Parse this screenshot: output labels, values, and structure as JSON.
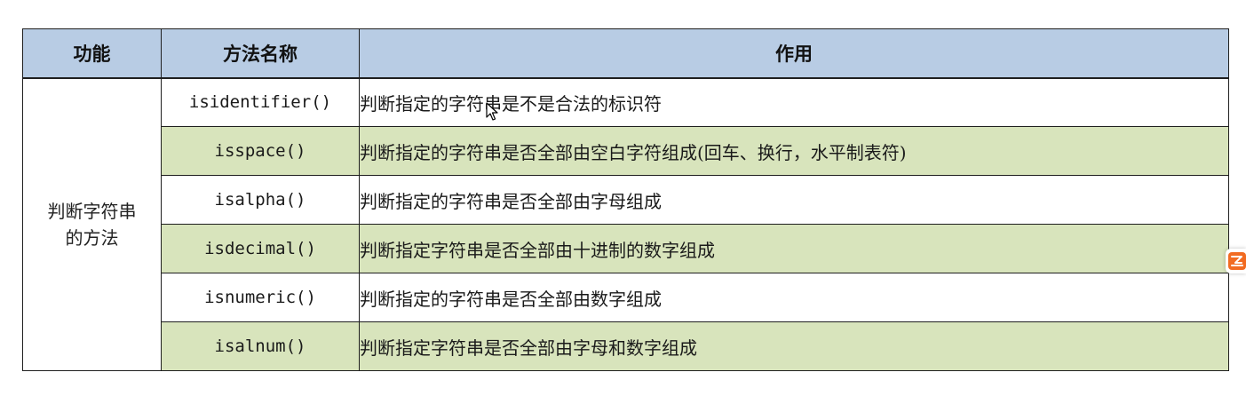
{
  "table": {
    "headers": {
      "function": "功能",
      "method_name": "方法名称",
      "purpose": "作用"
    },
    "category": {
      "line1": "判断字符串",
      "line2": "的方法"
    },
    "rows": [
      {
        "method": "isidentifier()",
        "description": "判断指定的字符串是不是合法的标识符",
        "shaded": false
      },
      {
        "method": "isspace()",
        "description": "判断指定的字符串是否全部由空白字符组成(回车、换行，水平制表符)",
        "shaded": true
      },
      {
        "method": "isalpha()",
        "description": "判断指定的字符串是否全部由字母组成",
        "shaded": false
      },
      {
        "method": "isdecimal()",
        "description": "判断指定字符串是否全部由十进制的数字组成",
        "shaded": true
      },
      {
        "method": "isnumeric()",
        "description": "判断指定的字符串是否全部由数字组成",
        "shaded": false
      },
      {
        "method": "isalnum()",
        "description": "判断指定字符串是否全部由字母和数字组成",
        "shaded": true
      }
    ]
  },
  "colors": {
    "header_bg": "#b8cce4",
    "shaded_row_bg": "#d8e4bc",
    "widget_accent": "#f26b21"
  },
  "icons": {
    "cursor": "mouse-pointer-icon",
    "side_widget": "app-badge-icon"
  }
}
